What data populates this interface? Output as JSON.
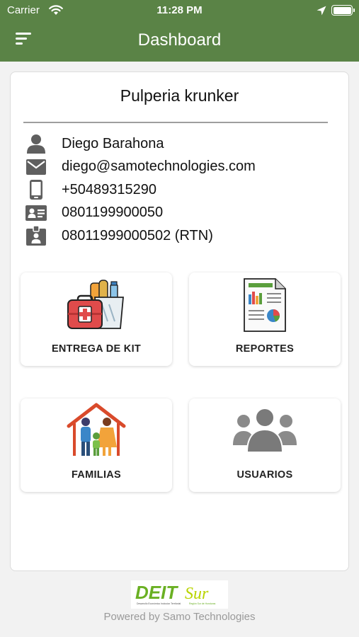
{
  "status_bar": {
    "carrier": "Carrier",
    "time": "11:28 PM"
  },
  "appbar": {
    "title": "Dashboard",
    "menu_icon": "sort-menu-icon"
  },
  "store": {
    "name": "Pulperia krunker"
  },
  "profile": [
    {
      "icon": "person-icon",
      "text": "Diego Barahona"
    },
    {
      "icon": "mail-icon",
      "text": "diego@samotechnologies.com"
    },
    {
      "icon": "phone-icon",
      "text": "+50489315290"
    },
    {
      "icon": "id-card-icon",
      "text": "0801199900050"
    },
    {
      "icon": "badge-icon",
      "text": "08011999000502 (RTN)"
    }
  ],
  "tiles": [
    {
      "icon": "kit-icon",
      "label": "ENTREGA DE KIT"
    },
    {
      "icon": "report-icon",
      "label": "REPORTES"
    },
    {
      "icon": "family-house-icon",
      "label": "FAMILIAS"
    },
    {
      "icon": "users-group-icon",
      "label": "USUARIOS"
    }
  ],
  "footer": {
    "logo_main": "DEIT",
    "logo_accent": "Sur",
    "logo_caption": "Desarrollo Económico Inclusivo Territorial",
    "logo_tagline": "Región Sur de Honduras",
    "powered_by": "Powered by Samo Technologies"
  },
  "colors": {
    "appbar": "#5a8346",
    "logo_green": "#6ab023",
    "logo_lime": "#b9d400"
  }
}
